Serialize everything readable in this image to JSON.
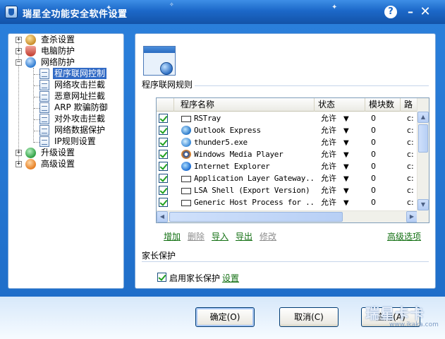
{
  "window": {
    "title": "瑞星全功能安全软件设置",
    "help_label": "?",
    "min_label": "–",
    "close_label": "✕"
  },
  "tree": {
    "items": [
      {
        "label": "查杀设置",
        "icon": "scan-icon",
        "color": "#c88c2a"
      },
      {
        "label": "电脑防护",
        "icon": "shield-icon",
        "color": "#c0392b"
      },
      {
        "label": "网络防护",
        "icon": "network-icon",
        "color": "#2f7bd0"
      },
      {
        "label": "程序联网控制",
        "icon": "page-icon"
      },
      {
        "label": "网络攻击拦截",
        "icon": "page-icon"
      },
      {
        "label": "恶意网址拦截",
        "icon": "page-icon"
      },
      {
        "label": "ARP 欺骗防御",
        "icon": "page-icon"
      },
      {
        "label": "对外攻击拦截",
        "icon": "page-icon"
      },
      {
        "label": "网络数据保护",
        "icon": "page-icon"
      },
      {
        "label": "IP规则设置",
        "icon": "page-icon"
      },
      {
        "label": "升级设置",
        "icon": "upgrade-icon",
        "color": "#2ea043"
      },
      {
        "label": "高级设置",
        "icon": "advanced-icon",
        "color": "#e67e22"
      }
    ],
    "expand_plus": "+",
    "expand_minus": "−"
  },
  "panel": {
    "section_title": "程序联网规则",
    "columns": [
      "程序名称",
      "状态",
      "模块数",
      "路"
    ],
    "rows": [
      {
        "name": "RSTray",
        "status": "允许",
        "modules": "0",
        "path": "c:"
      },
      {
        "name": "Outlook Express",
        "status": "允许",
        "modules": "0",
        "path": "c:"
      },
      {
        "name": "thunder5.exe",
        "status": "允许",
        "modules": "0",
        "path": "c:"
      },
      {
        "name": "Windows Media Player",
        "status": "允许",
        "modules": "0",
        "path": "c:"
      },
      {
        "name": "Internet Explorer",
        "status": "允许",
        "modules": "0",
        "path": "c:"
      },
      {
        "name": "Application Layer Gateway...",
        "status": "允许",
        "modules": "0",
        "path": "c:"
      },
      {
        "name": "LSA Shell (Export Version)",
        "status": "允许",
        "modules": "0",
        "path": "c:"
      },
      {
        "name": "Generic Host Process for ...",
        "status": "允许",
        "modules": "0",
        "path": "c:"
      }
    ],
    "status_arrow": "▼",
    "actions": {
      "add": "增加",
      "delete": "删除",
      "import": "导入",
      "export": "导出",
      "modify": "修改",
      "advanced": "高级选项"
    },
    "parental": {
      "title": "家长保护",
      "enable_label": "启用家长保护",
      "settings_link": "设置"
    }
  },
  "buttons": {
    "ok": "确定(O)",
    "cancel": "取消(C)",
    "apply": "应用(A)"
  },
  "watermark": {
    "big": "瑞星卡卡",
    "small": "www.ikaka.com"
  },
  "colors": {
    "title_bar": "#1c68c8",
    "link_green": "#137013",
    "selection": "#316ac5"
  }
}
